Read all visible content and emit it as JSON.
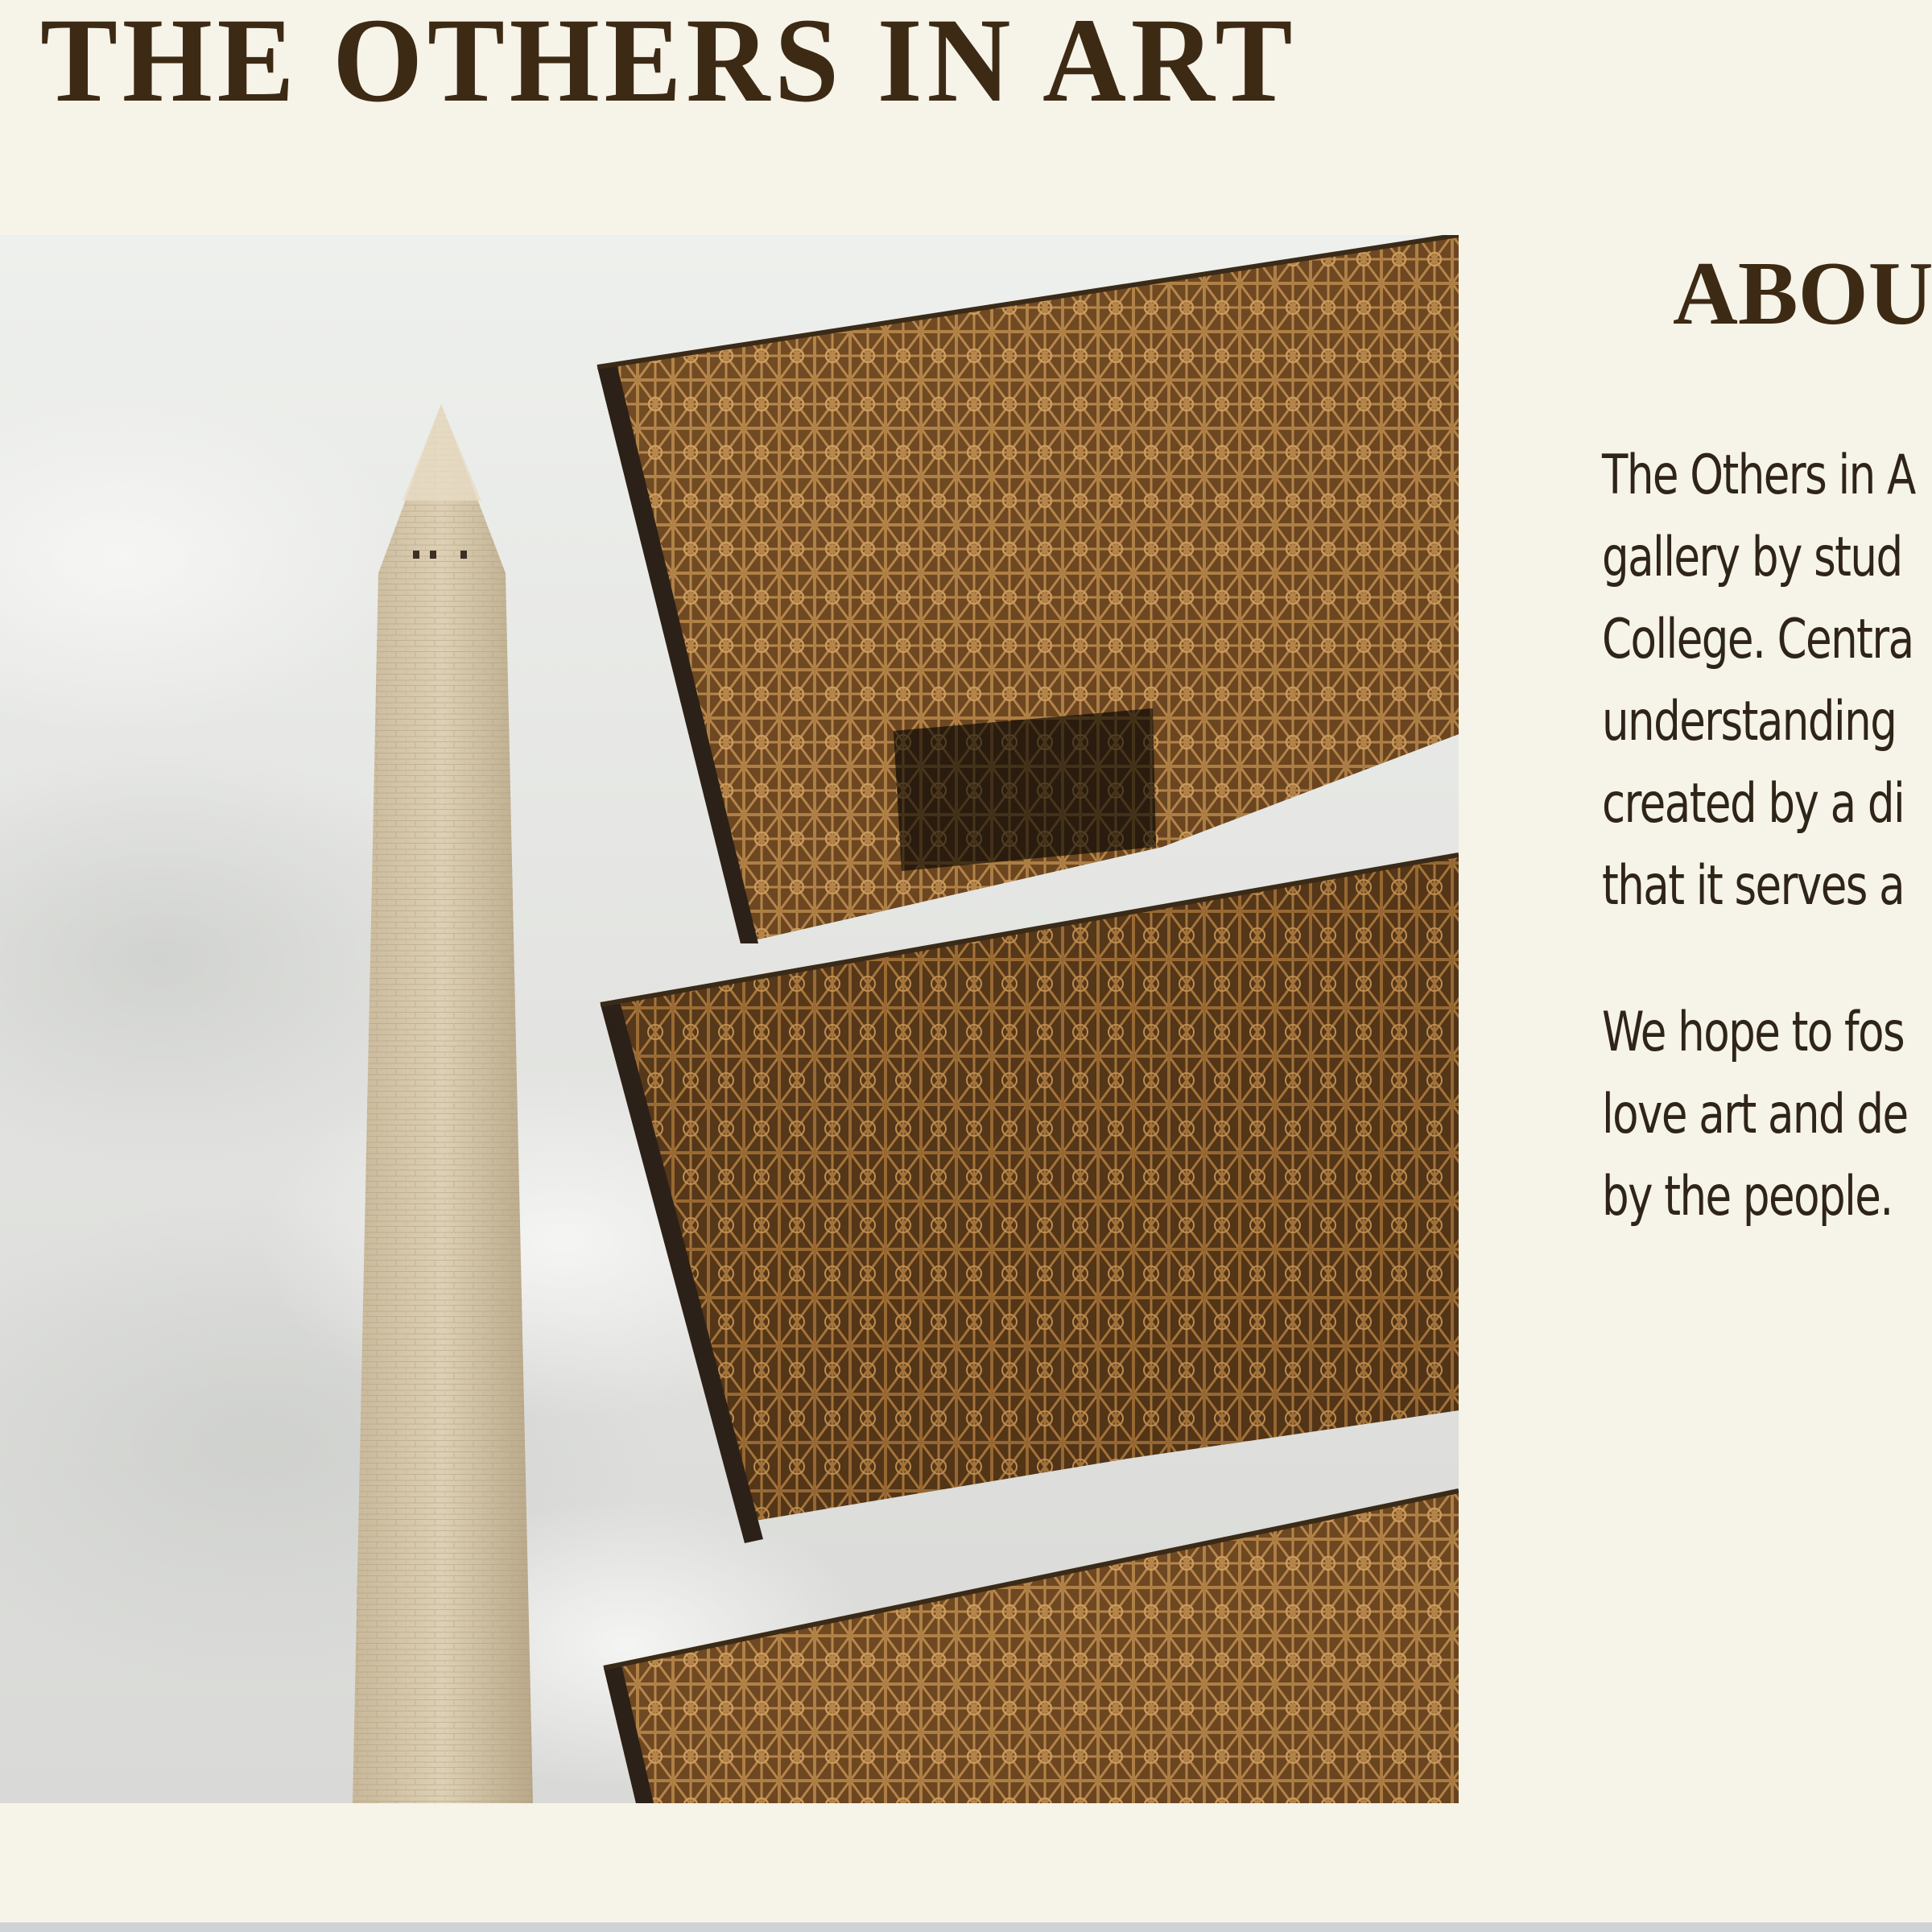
{
  "header": {
    "title": "THE OTHERS IN ART"
  },
  "hero": {
    "image_icon": "museum-and-obelisk-photo"
  },
  "about": {
    "heading": "ABOUT",
    "paragraph_1": "The Others in A\ngallery by stud\nCollege. Centra\nunderstanding\ncreated by a di\nthat it serves a",
    "paragraph_2": "We hope to fos\nlove art and de\nby the people."
  },
  "colors": {
    "background": "#f6f3e8",
    "title": "#3d2a14",
    "body_text": "#2f2418",
    "bronze": "#8a5f2c"
  }
}
